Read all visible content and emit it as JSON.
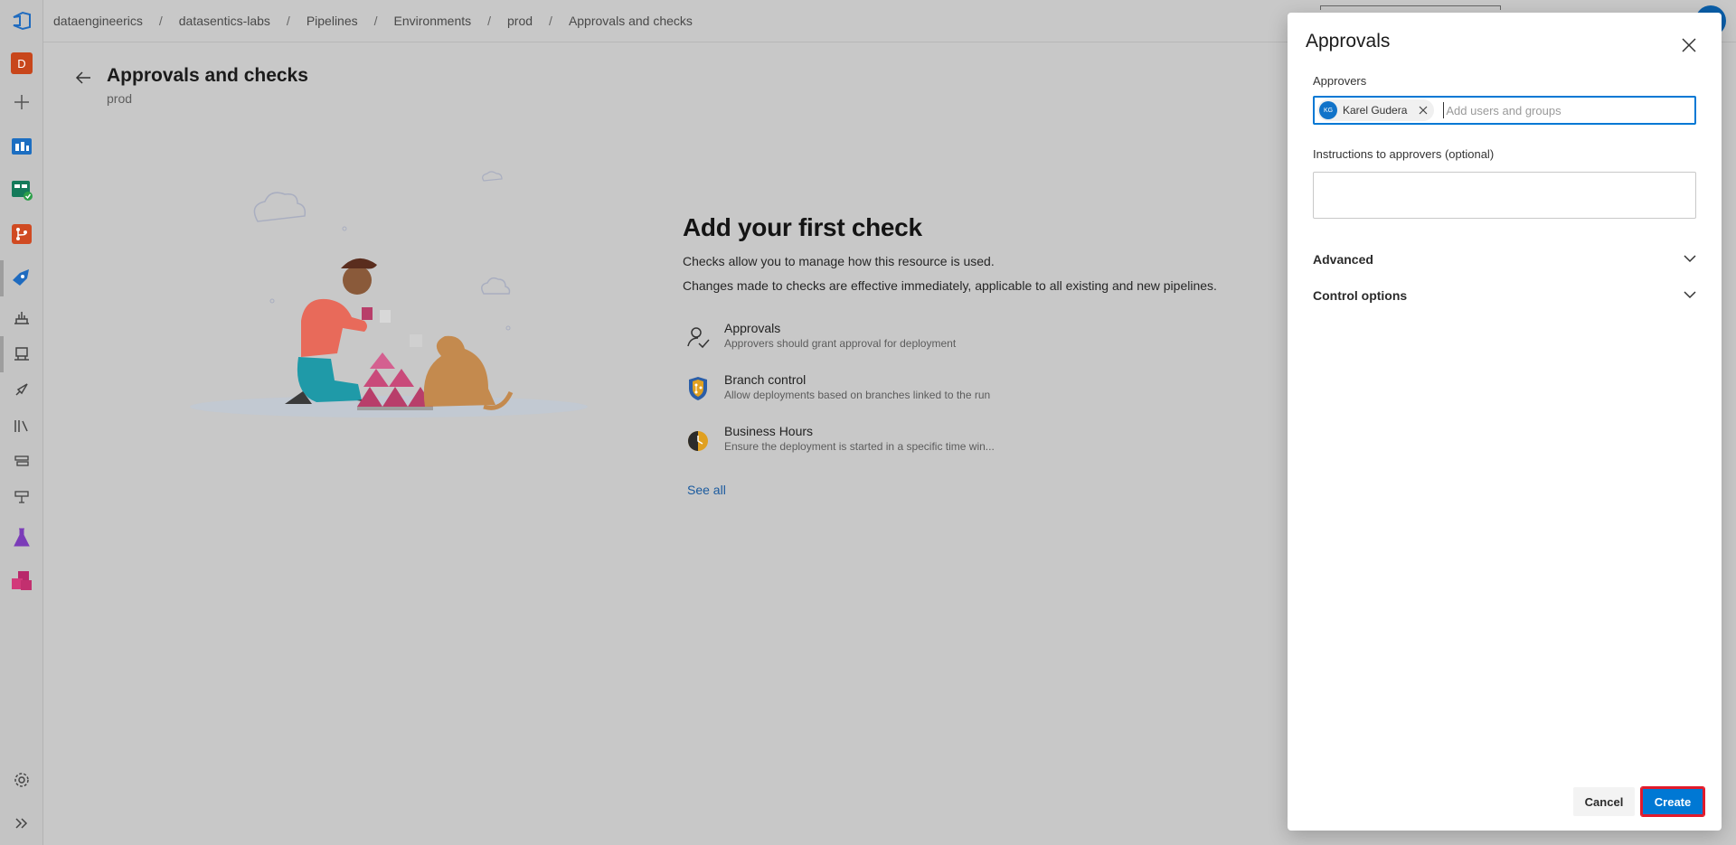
{
  "breadcrumb": [
    "dataengineerics",
    "datasentics-labs",
    "Pipelines",
    "Environments",
    "prod",
    "Approvals and checks"
  ],
  "rail": {
    "org_initial": "D",
    "items": [
      "azure-devops-logo-icon",
      "org-avatar-icon",
      "plus-icon",
      "overview-icon",
      "boards-icon",
      "repos-icon",
      "pipelines-icon",
      "builds-icon",
      "environments-icon",
      "releases-icon",
      "library-icon",
      "task-groups-icon",
      "deployment-groups-icon",
      "test-plans-icon",
      "artifacts-icon",
      "settings-gear-icon",
      "expand-chevrons-icon"
    ]
  },
  "page": {
    "title": "Approvals and checks",
    "subtitle": "prod"
  },
  "empty_state": {
    "title": "Add your first check",
    "line1": "Checks allow you to manage how this resource is used.",
    "line2": "Changes made to checks are effective immediately, applicable to all existing and new pipelines.",
    "checks": [
      {
        "name": "Approvals",
        "desc": "Approvers should grant approval for deployment",
        "icon": "user-check-icon"
      },
      {
        "name": "Branch control",
        "desc": "Allow deployments based on branches linked to the run",
        "icon": "branch-shield-icon"
      },
      {
        "name": "Business Hours",
        "desc": "Ensure the deployment is started in a specific time win...",
        "icon": "clock-icon"
      }
    ],
    "see_all": "See all"
  },
  "panel": {
    "title": "Approvals",
    "approvers_label": "Approvers",
    "chip": {
      "initials": "KG",
      "name": "Karel Gudera"
    },
    "approvers_placeholder": "Add users and groups",
    "instructions_label": "Instructions to approvers (optional)",
    "instructions_value": "",
    "sections": [
      "Advanced",
      "Control options"
    ],
    "cancel_label": "Cancel",
    "create_label": "Create"
  },
  "colors": {
    "accent": "#0078d4",
    "highlight": "#e11b2c",
    "link": "#1a5a9e"
  }
}
